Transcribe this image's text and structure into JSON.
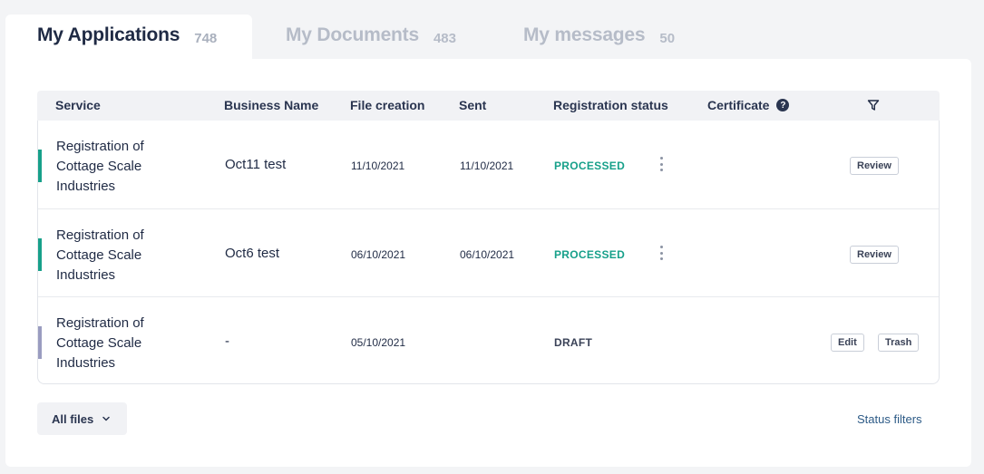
{
  "tabs": [
    {
      "label": "My Applications",
      "count": "748"
    },
    {
      "label": "My Documents",
      "count": "483"
    },
    {
      "label": "My messages",
      "count": "50"
    }
  ],
  "table": {
    "headers": {
      "service": "Service",
      "business": "Business Name",
      "file_creation": "File creation",
      "sent": "Sent",
      "registration_status": "Registration status",
      "certificate": "Certificate"
    },
    "rows": [
      {
        "service": "Registration of Cottage Scale Industries",
        "business": "Oct11 test",
        "created": "11/10/2021",
        "sent": "11/10/2021",
        "status": "PROCESSED",
        "actions": [
          "Review"
        ],
        "bar_color": "#17a08a"
      },
      {
        "service": "Registration of Cottage Scale Industries",
        "business": "Oct6 test",
        "created": "06/10/2021",
        "sent": "06/10/2021",
        "status": "PROCESSED",
        "actions": [
          "Review"
        ],
        "bar_color": "#17a08a"
      },
      {
        "service": "Registration of Cottage Scale Industries",
        "business": "-",
        "created": "05/10/2021",
        "sent": "",
        "status": "DRAFT",
        "actions": [
          "Edit",
          "Trash"
        ],
        "bar_color": "#9a9cc0"
      }
    ]
  },
  "footer": {
    "all_files_label": "All files",
    "status_filters_label": "Status filters"
  },
  "colors": {
    "processed": "#17a08a",
    "draft_bar": "#9a9cc0",
    "link": "#2c5a86"
  }
}
